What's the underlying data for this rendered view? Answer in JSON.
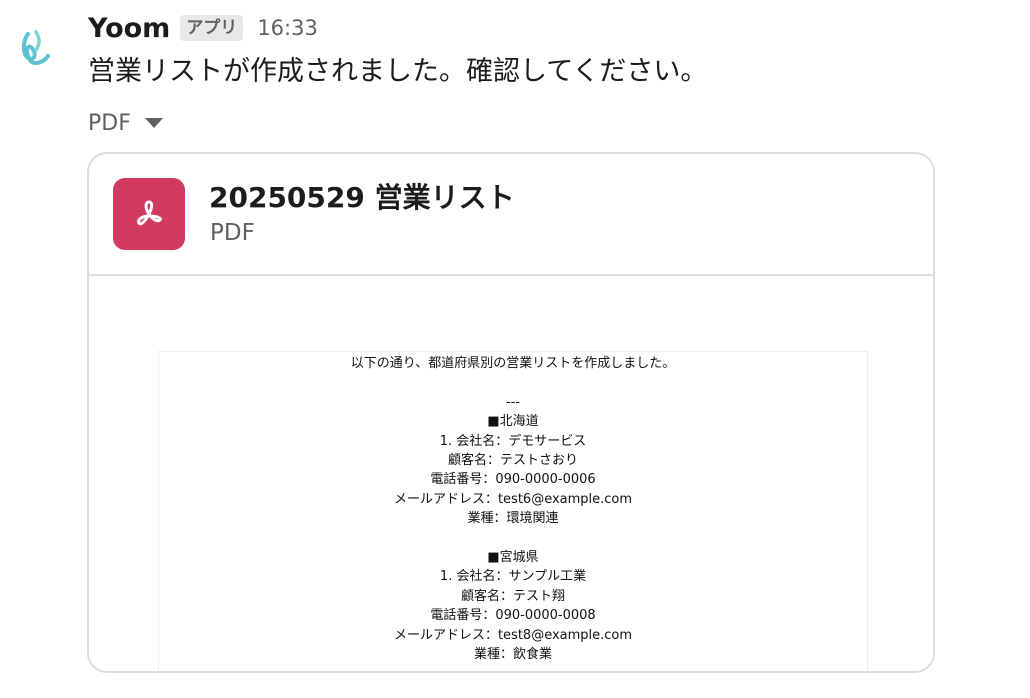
{
  "message": {
    "sender": "Yoom",
    "badge": "アプリ",
    "time": "16:33",
    "text": "営業リストが作成されました。確認してください。",
    "file_toggle_label": "PDF"
  },
  "file": {
    "name": "20250529 営業リスト",
    "type": "PDF",
    "icon": "pdf-icon",
    "accent_color": "#d13a5f"
  },
  "document": {
    "lines": [
      "以下の通り、都道府県別の営業リストを作成しました。",
      "",
      "---",
      "■北海道",
      "1. 会社名：デモサービス",
      "顧客名：テストさおり",
      "電話番号：090-0000-0006",
      "メールアドレス：test6@example.com",
      "業種：環境関連",
      "",
      "■宮城県",
      "1. 会社名：サンプル工業",
      "顧客名：テスト翔",
      "電話番号：090-0000-0008",
      "メールアドレス：test8@example.com",
      "業種：飲食業"
    ]
  }
}
